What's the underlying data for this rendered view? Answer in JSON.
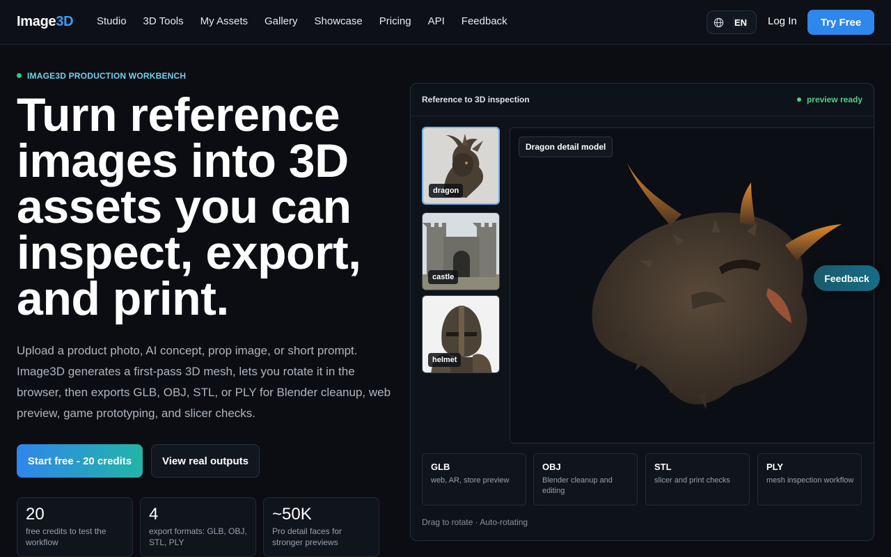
{
  "nav": {
    "logo_a": "Image",
    "logo_b": "3D",
    "links": [
      "Studio",
      "3D Tools",
      "My Assets",
      "Gallery",
      "Showcase",
      "Pricing",
      "API",
      "Feedback"
    ],
    "lang": "EN",
    "login": "Log In",
    "try_free": "Try Free"
  },
  "hero": {
    "eyebrow": "IMAGE3D PRODUCTION WORKBENCH",
    "headline": "Turn reference images into 3D assets you can inspect, export, and print.",
    "lead": "Upload a product photo, AI concept, prop image, or short prompt. Image3D generates a first-pass 3D mesh, lets you rotate it in the browser, then exports GLB, OBJ, STL, or PLY for Blender cleanup, web preview, game prototyping, and slicer checks.",
    "cta_primary": "Start free - 20 credits",
    "cta_secondary": "View real outputs",
    "stats": [
      {
        "num": "20",
        "label": "free credits to test the workflow"
      },
      {
        "num": "4",
        "label": "export formats: GLB, OBJ, STL, PLY"
      },
      {
        "num": "~50K",
        "label": "Pro detail faces for stronger previews"
      }
    ]
  },
  "panel": {
    "title": "Reference to 3D inspection",
    "status": "preview ready",
    "thumbs": [
      "dragon",
      "castle",
      "helmet"
    ],
    "model_tag": "Dragon detail model",
    "formats": [
      {
        "key": "GLB",
        "desc": "web, AR, store preview"
      },
      {
        "key": "OBJ",
        "desc": "Blender cleanup and editing"
      },
      {
        "key": "STL",
        "desc": "slicer and print checks"
      },
      {
        "key": "PLY",
        "desc": "mesh inspection workflow"
      }
    ],
    "hint": "Drag to rotate · Auto-rotating"
  },
  "floating": {
    "feedback": "Feedback"
  },
  "colors": {
    "accent": "#2f86ec",
    "status_green": "#4fd08d",
    "eyebrow": "#6bd3ee"
  }
}
